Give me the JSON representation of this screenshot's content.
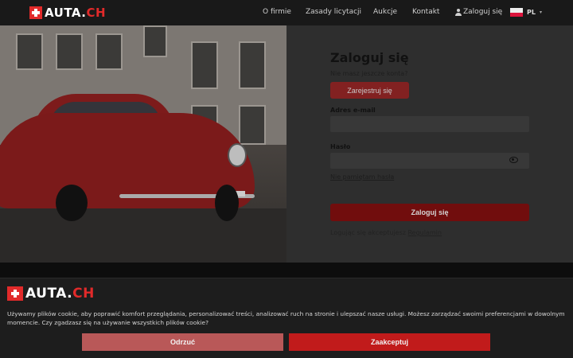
{
  "header": {
    "logo_main": "AUTA.",
    "logo_suffix": "CH",
    "nav": [
      {
        "label": "O firmie"
      },
      {
        "label": "Zasady licytacji"
      },
      {
        "label": "Aukcje"
      },
      {
        "label": "Kontakt"
      }
    ],
    "login_label": "Zaloguj się",
    "language": "PL"
  },
  "login": {
    "title": "Zaloguj się",
    "no_account": "Nie masz jeszcze konta?",
    "register_label": "Zarejestruj się",
    "email_label": "Adres e-mail",
    "email_value": "",
    "password_label": "Hasło",
    "password_value": "",
    "forgot_label": "Nie pamiętam hasła",
    "submit_label": "Zaloguj się",
    "terms_prefix": "Logując się akceptujesz",
    "terms_link": "Regulamin"
  },
  "cookie_banner": {
    "logo_main": "AUTA.",
    "logo_suffix": "CH",
    "text": "Używamy plików cookie, aby poprawić komfort przeglądania, personalizować treści, analizować ruch na stronie i ulepszać nasze usługi. Możesz zarządzać swoimi preferencjami w dowolnym momencie. Czy zgadzasz się na używanie wszystkich plików cookie?",
    "reject_label": "Odrzuć",
    "accept_label": "Zaakceptuj"
  },
  "colors": {
    "brand_red": "#e12a2a",
    "primary_button": "#710d0d",
    "accept_button": "#c11b1b",
    "reject_button": "#b95858"
  },
  "icons": [
    "swiss-cross-icon",
    "user-icon",
    "poland-flag-icon",
    "chevron-down-icon",
    "eye-icon"
  ]
}
